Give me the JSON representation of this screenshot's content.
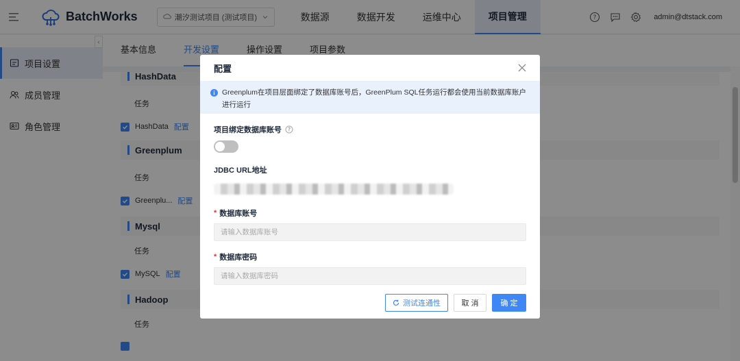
{
  "app": {
    "name": "BatchWorks"
  },
  "header": {
    "project_select": "潮汐测试项目 (测试项目)",
    "nav": [
      "数据源",
      "数据开发",
      "运维中心",
      "项目管理"
    ],
    "user": "admin@dtstack.com"
  },
  "sidebar": {
    "items": [
      {
        "label": "项目设置"
      },
      {
        "label": "成员管理"
      },
      {
        "label": "角色管理"
      }
    ]
  },
  "tabs": [
    "基本信息",
    "开发设置",
    "操作设置",
    "项目参数"
  ],
  "background": {
    "sections": [
      {
        "title": "HashData",
        "task_label": "任务",
        "item": "HashData",
        "config": "配置"
      },
      {
        "title": "Greenplum",
        "task_label": "任务",
        "item": "Greenplu...",
        "config": "配置"
      },
      {
        "title": "Mysql",
        "task_label": "任务",
        "item": "MySQL",
        "config": "配置"
      },
      {
        "title": "Hadoop",
        "task_label": "任务"
      }
    ]
  },
  "modal": {
    "title": "配置",
    "alert": "Greenplum在项目层面绑定了数据库账号后，GreenPlum SQL任务运行都会使用当前数据库账户进行运行",
    "bind_label": "项目绑定数据库账号",
    "jdbc_label": "JDBC URL地址",
    "account_label": "数据库账号",
    "account_placeholder": "请输入数据库账号",
    "password_label": "数据库密码",
    "password_placeholder": "请输入数据库密码",
    "test_button": "测试连通性",
    "cancel_button": "取 消",
    "ok_button": "确 定"
  },
  "colors": {
    "primary": "#3f87f5",
    "alert_bg": "#e9f1fd",
    "required": "#e2353f"
  }
}
